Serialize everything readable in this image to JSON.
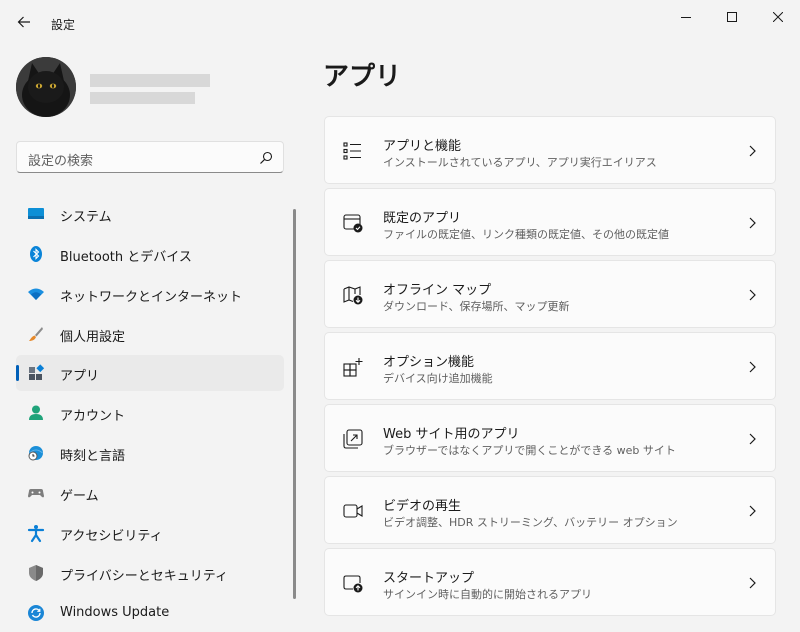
{
  "window": {
    "title": "設定"
  },
  "search": {
    "placeholder": "設定の検索"
  },
  "sidebar": {
    "items": [
      {
        "label": "システム",
        "icon": "system-icon",
        "selected": false
      },
      {
        "label": "Bluetooth とデバイス",
        "icon": "bluetooth-icon",
        "selected": false
      },
      {
        "label": "ネットワークとインターネット",
        "icon": "wifi-icon",
        "selected": false
      },
      {
        "label": "個人用設定",
        "icon": "brush-icon",
        "selected": false
      },
      {
        "label": "アプリ",
        "icon": "apps-icon",
        "selected": true
      },
      {
        "label": "アカウント",
        "icon": "account-icon",
        "selected": false
      },
      {
        "label": "時刻と言語",
        "icon": "time-language-icon",
        "selected": false
      },
      {
        "label": "ゲーム",
        "icon": "gamepad-icon",
        "selected": false
      },
      {
        "label": "アクセシビリティ",
        "icon": "accessibility-icon",
        "selected": false
      },
      {
        "label": "プライバシーとセキュリティ",
        "icon": "shield-icon",
        "selected": false
      },
      {
        "label": "Windows Update",
        "icon": "windows-update-icon",
        "selected": false
      }
    ]
  },
  "main": {
    "title": "アプリ",
    "cards": [
      {
        "title": "アプリと機能",
        "subtitle": "インストールされているアプリ、アプリ実行エイリアス",
        "icon": "apps-list-icon"
      },
      {
        "title": "既定のアプリ",
        "subtitle": "ファイルの既定値、リンク種類の既定値、その他の既定値",
        "icon": "default-apps-icon"
      },
      {
        "title": "オフライン マップ",
        "subtitle": "ダウンロード、保存場所、マップ更新",
        "icon": "offline-map-icon"
      },
      {
        "title": "オプション機能",
        "subtitle": "デバイス向け追加機能",
        "icon": "optional-features-icon"
      },
      {
        "title": "Web サイト用のアプリ",
        "subtitle": "ブラウザーではなくアプリで開くことができる web サイト",
        "icon": "web-apps-icon"
      },
      {
        "title": "ビデオの再生",
        "subtitle": "ビデオ調整、HDR ストリーミング、バッテリー オプション",
        "icon": "video-icon"
      },
      {
        "title": "スタートアップ",
        "subtitle": "サインイン時に自動的に開始されるアプリ",
        "icon": "startup-icon"
      }
    ]
  },
  "colors": {
    "accent": "#005fb8",
    "background": "#f3f3f3",
    "card": "#fbfbfb"
  }
}
